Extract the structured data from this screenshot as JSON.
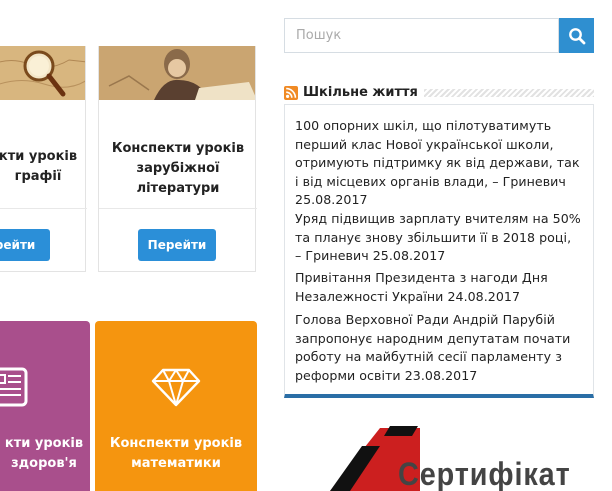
{
  "cards": [
    {
      "title_lines": [
        "кти уроків",
        "графії"
      ],
      "button": "ерейти"
    },
    {
      "title_lines": [
        "Конспекти уроків",
        "зарубіжної",
        "літератури"
      ],
      "button": "Перейти"
    }
  ],
  "tiles": [
    {
      "title_lines": [
        "кти уроків",
        "здоров'я"
      ],
      "icon": "document-icon",
      "color": "#a94f8c"
    },
    {
      "title_lines": [
        "Конспекти уроків",
        "математики"
      ],
      "icon": "diamond-icon",
      "color": "#f5950f"
    }
  ],
  "search": {
    "placeholder": "Пошук",
    "icon": "search-icon"
  },
  "widget": {
    "title": "Шкільне життя",
    "icon": "rss-icon",
    "items": [
      {
        "lines": [
          "100 опорних шкіл, що пілотуватимуть",
          "перший клас Нової української школи,",
          "отримують підтримку як від держави, так",
          "і від місцевих органів влади, – Гриневич",
          "25.08.2017"
        ]
      },
      {
        "lines": [
          "Уряд підвищив зарплату вчителям на 50%",
          "та планує знову збільшити її в 2018 році,",
          "– Гриневич 25.08.2017"
        ]
      },
      {
        "lines": [
          "Привітання Президента з нагоди Дня",
          "Незалежності України 24.08.2017"
        ]
      },
      {
        "lines": [
          "Голова Верховної Ради Андрій Парубій",
          "запропонує народним депутатам почати",
          "роботу на майбутній сесії парламенту з",
          "реформи освіти 23.08.2017"
        ]
      }
    ]
  },
  "banner": {
    "text": "Сертифікат"
  },
  "colors": {
    "accent": "#2b8fd8",
    "widget_border": "#2a6ea6",
    "rss": "#f08a24"
  }
}
